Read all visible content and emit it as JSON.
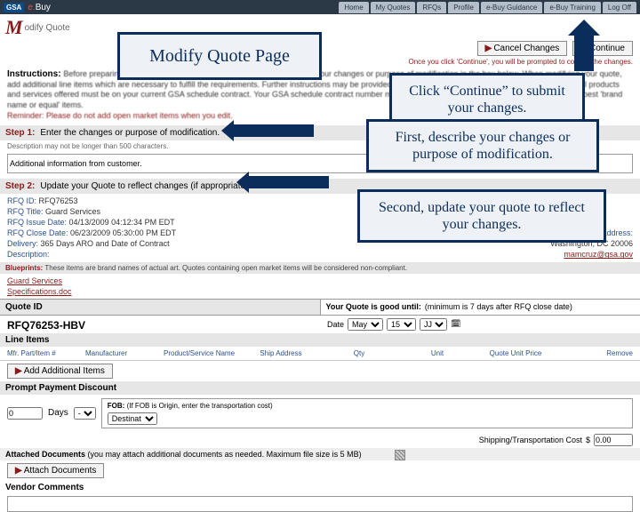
{
  "topbar": {
    "logo": "GSA",
    "brand_e": "e.",
    "brand_buy": "Buy",
    "nav": [
      "Home",
      "My Quotes",
      "RFQs",
      "Profile",
      "e-Buy Guidance",
      "e-Buy Training",
      "Log Off"
    ]
  },
  "title": {
    "m": "M",
    "rest": "odify Quote"
  },
  "actions": {
    "cancel": "Cancel Changes",
    "cont": "Continue"
  },
  "note_top": "Once you click 'Continue', you will be prompted to confirm the changes.",
  "instr_h": "Instructions:",
  "instr_body": "Before preparing your quote modification for this RFQ, please describe your changes or purpose of modification in the box below. When modifying your quote, add additional line items which are necessary to fulfill the requirements. Further instructions may be provided in the attached docs or in the vendor comment box. All products and services offered must be on your current GSA schedule contract. Your GSA schedule contract number must be on a portion or all of the line items, and/or offer best 'brand name or equal' items.",
  "reminder": "Reminder: Please do not add open market items when you edit.",
  "step1": {
    "label": "Step 1:",
    "text": "Enter the changes or purpose of modification.",
    "sub": "Description may not be longer than 500 characters.",
    "value": "Additional information from customer."
  },
  "step2": {
    "label": "Step 2:",
    "text": "Update your Quote to reflect changes (if appropriate)."
  },
  "rfq": {
    "id_l": "RFQ ID:",
    "id": "RFQ76253",
    "title_l": "RFQ Title:",
    "title": "Guard Services",
    "issue_l": "RFQ Issue Date:",
    "issue": "04/13/2009 04:12:34 PM EDT",
    "close_l": "RFQ Close Date:",
    "close": "06/23/2009 05:30:00 PM EDT",
    "deliv_l": "Delivery:",
    "deliv": "365 Days ARO and Date of Contract",
    "desc_l": "Description:",
    "ship_l": "Shipping Address:",
    "ship_city": "Washington, DC 20006",
    "ship_email": "mamcruz@gsa.gov",
    "doc1": "Guard Services",
    "doc2": "Specifications.doc"
  },
  "bluep": {
    "lab": "Blueprints:",
    "txt": "These items are brand names of actual art. Quotes containing open market items will be considered non-compliant."
  },
  "quote": {
    "id_l": "Quote ID",
    "id": "RFQ76253-HBV",
    "good_l": "Your Quote is good until:",
    "good_note": "(minimum is 7 days after RFQ close date)",
    "date_l": "Date",
    "m": "May",
    "d": "15",
    "y": "JJ"
  },
  "line": {
    "hd": "Line Items",
    "cols": [
      "Mfr. Part/Item #",
      "Manufacturer",
      "Product/Service Name",
      "Ship Address",
      "Qty",
      "Unit",
      "Quote Unit Price",
      "Remove"
    ],
    "add": "Add Additional Items"
  },
  "prompt": {
    "hd": "Prompt Payment Discount",
    "pct": "0",
    "days_l": "Days",
    "days": "-",
    "fob_l": "FOB:",
    "fob_note": "(If FOB is Origin, enter the transportation cost)",
    "fob_sel": "Destinat"
  },
  "trans": {
    "lab": "Shipping/Transportation Cost",
    "cur": "$",
    "val": "0.00"
  },
  "attach": {
    "hd": "Attached Documents",
    "note": "(you may attach additional documents as needed. Maximum file size is 5 MB)",
    "btn": "Attach Documents"
  },
  "vendor": "Vendor Comments",
  "anno": {
    "title": "Modify Quote Page",
    "a1": "Click “Continue” to submit your changes.",
    "a2": "First, describe your changes or purpose of modification.",
    "a3": "Second, update your quote to reflect your changes."
  }
}
